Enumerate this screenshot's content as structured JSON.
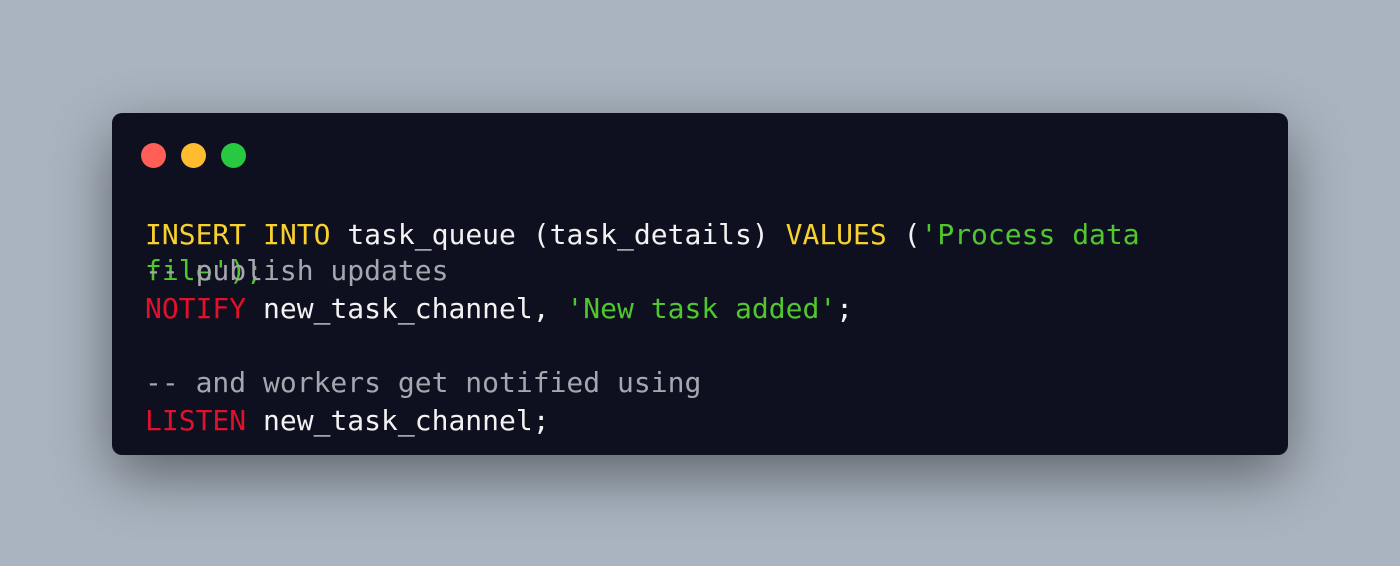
{
  "window": {
    "controls": [
      "close",
      "minimize",
      "maximize"
    ],
    "colors": {
      "background": "#0e1020",
      "close": "#ff5f57",
      "minimize": "#febc2e",
      "maximize": "#28c840",
      "keyword_yellow": "#f8d12f",
      "keyword_red": "#e0112b",
      "string": "#4fc72e",
      "comment": "#a4a7ae",
      "text": "#f2f2f2"
    }
  },
  "code": {
    "line1": {
      "kw_insert": "INSERT",
      "kw_into": "INTO",
      "text1": "task_queue (task_details)",
      "kw_values": "VALUES",
      "paren": "(",
      "string": "'Process data"
    },
    "line2": {
      "string_tail": "file');",
      "comment": "-- publish updates"
    },
    "line3": {
      "kw_notify": "NOTIFY",
      "text": "new_task_channel,",
      "string": "'New task added'",
      "semicolon": ";"
    },
    "line5": {
      "comment": "-- and workers get notified using"
    },
    "line6": {
      "kw_listen": "LISTEN",
      "text": "new_task_channel;"
    }
  }
}
